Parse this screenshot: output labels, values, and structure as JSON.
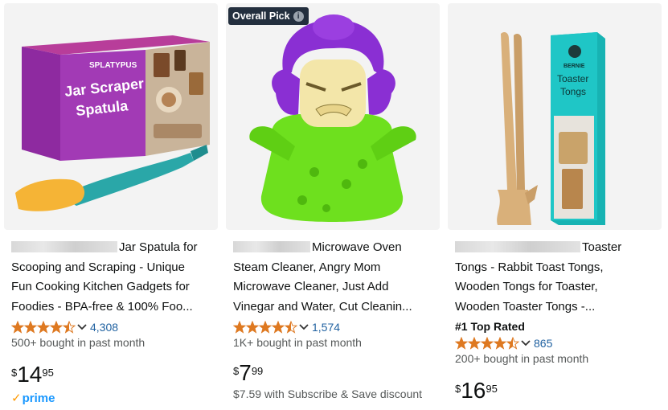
{
  "products": [
    {
      "title_lines": [
        "Jar Spatula for",
        "Scooping and Scraping - Unique",
        "Fun Cooking Kitchen Gadgets for",
        "Foodies - BPA-free & 100% Foo..."
      ],
      "rating": 4.5,
      "review_count": "4,308",
      "bought": "500+ bought in past month",
      "price": {
        "symbol": "$",
        "whole": "14",
        "fraction": "95"
      },
      "prime": "prime",
      "box_brand": "SPLATYPUS",
      "box_title_1": "Jar Scraper",
      "box_title_2": "Spatula"
    },
    {
      "badge": "Overall Pick",
      "title_lines": [
        "Microwave Oven",
        "Steam Cleaner, Angry Mom",
        "Microwave Cleaner, Just Add",
        "Vinegar and Water, Cut Cleanin..."
      ],
      "rating": 4.5,
      "review_count": "1,574",
      "bought": "1K+ bought in past month",
      "price": {
        "symbol": "$",
        "whole": "7",
        "fraction": "99"
      },
      "subsave": "$7.59 with Subscribe & Save discount"
    },
    {
      "title_lines": [
        "Toaster",
        "Tongs - Rabbit Toast Tongs,",
        "Wooden Tongs for Toaster,",
        "Wooden Toaster Tongs -..."
      ],
      "top_rated": "#1 Top Rated",
      "rating": 4.5,
      "review_count": "865",
      "bought": "200+ bought in past month",
      "price": {
        "symbol": "$",
        "whole": "16",
        "fraction": "95"
      },
      "box_brand": "BERNIE",
      "box_title_1": "Toaster",
      "box_title_2": "Tongs"
    }
  ],
  "colors": {
    "star": "#de7921",
    "link": "#2162a1",
    "badge_bg": "#232f3e",
    "prime_blue": "#1a98ff",
    "prime_check": "#ff9900"
  }
}
